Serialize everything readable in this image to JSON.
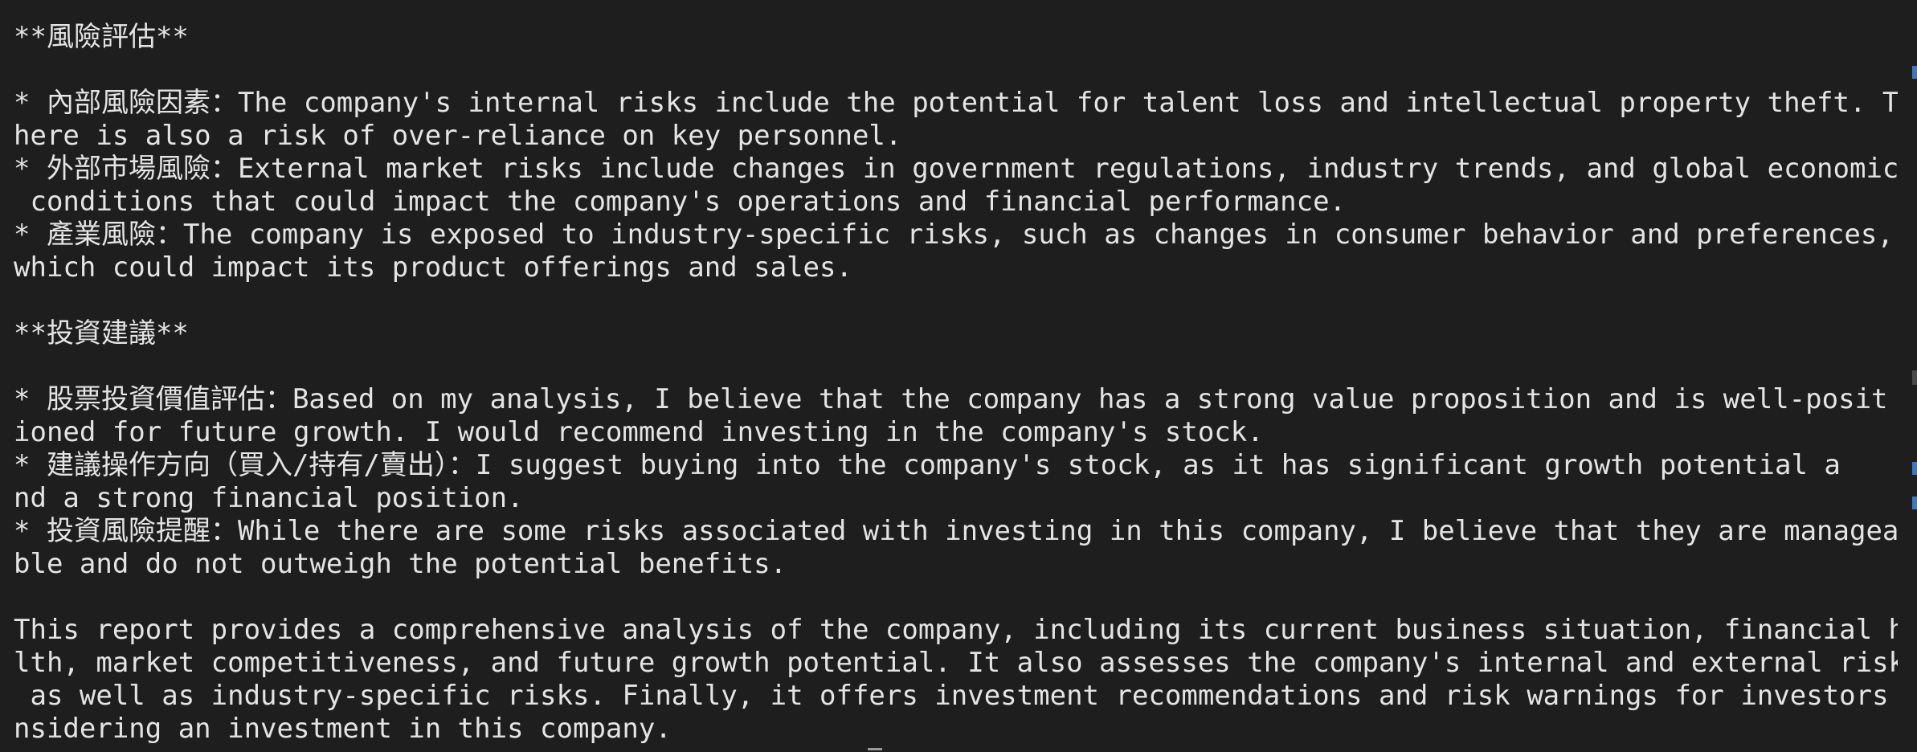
{
  "lines": [
    "**風險評估**",
    "",
    "* 內部風險因素：The company's internal risks include the potential for talent loss and intellectual property theft. T",
    "here is also a risk of over-reliance on key personnel.",
    "* 外部市場風險：External market risks include changes in government regulations, industry trends, and global economic",
    " conditions that could impact the company's operations and financial performance.",
    "* 產業風險：The company is exposed to industry-specific risks, such as changes in consumer behavior and preferences,",
    "which could impact its product offerings and sales.",
    "",
    "**投資建議**",
    "",
    "* 股票投資價值評估：Based on my analysis, I believe that the company has a strong value proposition and is well-posit",
    "ioned for future growth. I would recommend investing in the company's stock.",
    "* 建議操作方向（買入/持有/賣出）：I suggest buying into the company's stock, as it has significant growth potential a",
    "nd a strong financial position.",
    "* 投資風險提醒：While there are some risks associated with investing in this company, I believe that they are managea",
    "ble and do not outweigh the potential benefits.",
    "",
    "This report provides a comprehensive analysis of the company, including its current business situation, financial hea",
    "lth, market competitiveness, and future growth potential. It also assesses the company's internal and external risks,",
    " as well as industry-specific risks. Finally, it offers investment recommendations and risk warnings for investors co",
    "nsidering an investment in this company."
  ]
}
